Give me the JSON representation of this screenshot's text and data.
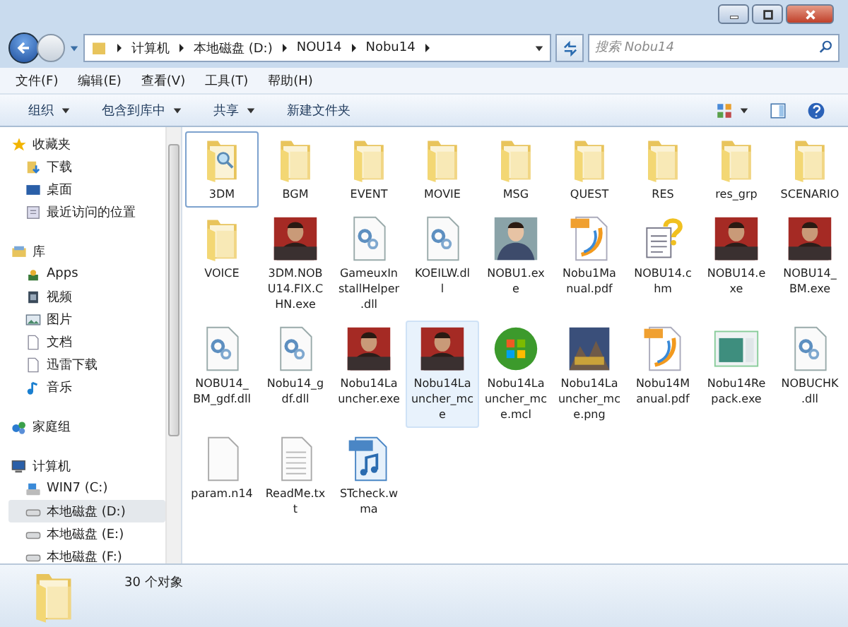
{
  "address": {
    "crumbs": [
      "计算机",
      "本地磁盘 (D:)",
      "NOU14",
      "Nobu14"
    ]
  },
  "search": {
    "placeholder": "搜索 Nobu14"
  },
  "menu": [
    "文件(F)",
    "编辑(E)",
    "查看(V)",
    "工具(T)",
    "帮助(H)"
  ],
  "toolbar": [
    {
      "label": "组织",
      "dropdown": true
    },
    {
      "label": "包含到库中",
      "dropdown": true
    },
    {
      "label": "共享",
      "dropdown": true
    },
    {
      "label": "新建文件夹",
      "dropdown": false
    }
  ],
  "sidebar": {
    "groups": [
      {
        "label": "收藏夹",
        "kind": "star",
        "items": [
          {
            "label": "下载",
            "kind": "download",
            "selected": false
          },
          {
            "label": "桌面",
            "kind": "desktop",
            "selected": false
          },
          {
            "label": "最近访问的位置",
            "kind": "recent",
            "selected": false
          }
        ]
      },
      {
        "label": "库",
        "kind": "library",
        "items": [
          {
            "label": "Apps",
            "kind": "apps",
            "selected": false
          },
          {
            "label": "视频",
            "kind": "video",
            "selected": false
          },
          {
            "label": "图片",
            "kind": "image",
            "selected": false
          },
          {
            "label": "文档",
            "kind": "doc",
            "selected": false
          },
          {
            "label": "迅雷下载",
            "kind": "doc",
            "selected": false
          },
          {
            "label": "音乐",
            "kind": "music",
            "selected": false
          }
        ]
      },
      {
        "label": "家庭组",
        "kind": "homegroup"
      },
      {
        "label": "计算机",
        "kind": "computer",
        "items": [
          {
            "label": "WIN7 (C:)",
            "kind": "sysdrive",
            "selected": false
          },
          {
            "label": "本地磁盘 (D:)",
            "kind": "drive",
            "selected": true
          },
          {
            "label": "本地磁盘 (E:)",
            "kind": "drive",
            "selected": false
          },
          {
            "label": "本地磁盘 (F:)",
            "kind": "drive",
            "selected": false
          }
        ]
      }
    ]
  },
  "files": [
    {
      "lines": [
        "3DM"
      ],
      "kind": "folder-search",
      "selected": false,
      "focused": true
    },
    {
      "lines": [
        "BGM"
      ],
      "kind": "folder",
      "selected": false,
      "focused": false
    },
    {
      "lines": [
        "EVENT"
      ],
      "kind": "folder",
      "selected": false,
      "focused": false
    },
    {
      "lines": [
        "MOVIE"
      ],
      "kind": "folder",
      "selected": false,
      "focused": false
    },
    {
      "lines": [
        "MSG"
      ],
      "kind": "folder",
      "selected": false,
      "focused": false
    },
    {
      "lines": [
        "QUEST"
      ],
      "kind": "folder",
      "selected": false,
      "focused": false
    },
    {
      "lines": [
        "RES"
      ],
      "kind": "folder",
      "selected": false,
      "focused": false
    },
    {
      "lines": [
        "res_grp"
      ],
      "kind": "folder",
      "selected": false,
      "focused": false
    },
    {
      "lines": [
        "SCENARIO"
      ],
      "kind": "folder",
      "selected": false,
      "focused": false
    },
    {
      "lines": [
        "VOICE"
      ],
      "kind": "folder",
      "selected": false,
      "focused": false
    },
    {
      "lines": [
        "3DM.NOB",
        "U14.FIX.C",
        "HN.exe"
      ],
      "kind": "game",
      "selected": false,
      "focused": false
    },
    {
      "lines": [
        "GameuxIn",
        "stallHelper",
        ".dll"
      ],
      "kind": "dll",
      "selected": false,
      "focused": false
    },
    {
      "lines": [
        "KOEILW.dl",
        "l"
      ],
      "kind": "dll",
      "selected": false,
      "focused": false
    },
    {
      "lines": [
        "NOBU1.ex",
        "e"
      ],
      "kind": "portrait",
      "selected": false,
      "focused": false
    },
    {
      "lines": [
        "Nobu1Ma",
        "nual.pdf"
      ],
      "kind": "pdf",
      "selected": false,
      "focused": false
    },
    {
      "lines": [
        "NOBU14.c",
        "hm"
      ],
      "kind": "chm",
      "selected": false,
      "focused": false
    },
    {
      "lines": [
        "NOBU14.e",
        "xe"
      ],
      "kind": "game",
      "selected": false,
      "focused": false
    },
    {
      "lines": [
        "NOBU14_",
        "BM.exe"
      ],
      "kind": "game",
      "selected": false,
      "focused": false
    },
    {
      "lines": [
        "NOBU14_",
        "BM_gdf.dll"
      ],
      "kind": "dll",
      "selected": false,
      "focused": false
    },
    {
      "lines": [
        "Nobu14_g",
        "df.dll"
      ],
      "kind": "dll",
      "selected": false,
      "focused": false
    },
    {
      "lines": [
        "Nobu14La",
        "uncher.exe"
      ],
      "kind": "game",
      "selected": false,
      "focused": false
    },
    {
      "lines": [
        "Nobu14La",
        "uncher_mc",
        "e"
      ],
      "kind": "game",
      "selected": true,
      "focused": false
    },
    {
      "lines": [
        "Nobu14La",
        "uncher_mc",
        "e.mcl"
      ],
      "kind": "windows",
      "selected": false,
      "focused": false
    },
    {
      "lines": [
        "Nobu14La",
        "uncher_mc",
        "e.png"
      ],
      "kind": "cover",
      "selected": false,
      "focused": false
    },
    {
      "lines": [
        "Nobu14M",
        "anual.pdf"
      ],
      "kind": "pdf",
      "selected": false,
      "focused": false
    },
    {
      "lines": [
        "Nobu14Re",
        "pack.exe"
      ],
      "kind": "app-window",
      "selected": false,
      "focused": false
    },
    {
      "lines": [
        "NOBUCHK",
        ".dll"
      ],
      "kind": "dll",
      "selected": false,
      "focused": false
    },
    {
      "lines": [
        "param.n14"
      ],
      "kind": "blank",
      "selected": false,
      "focused": false
    },
    {
      "lines": [
        "ReadMe.tx",
        "t"
      ],
      "kind": "txt",
      "selected": false,
      "focused": false
    },
    {
      "lines": [
        "STcheck.w",
        "ma"
      ],
      "kind": "wma",
      "selected": false,
      "focused": false
    }
  ],
  "status": {
    "count": "30 个对象"
  }
}
